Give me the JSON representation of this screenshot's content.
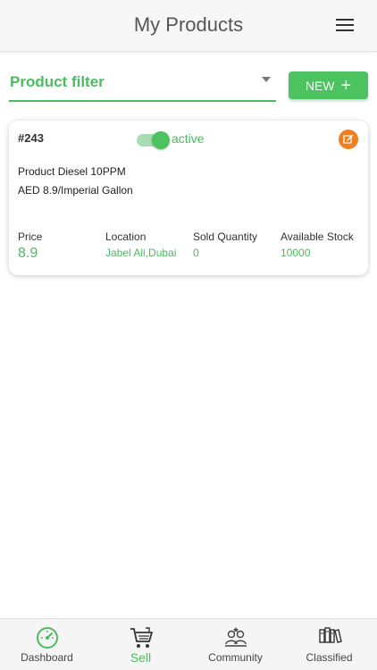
{
  "header": {
    "title": "My Products",
    "menu_icon": "hamburger-menu-icon"
  },
  "filter": {
    "label": "Product filter",
    "caret_icon": "dropdown-caret-icon"
  },
  "new_button": {
    "label": "NEW",
    "icon": "plus-icon"
  },
  "product": {
    "id": "#243",
    "active": true,
    "status_text": "active",
    "name": "Product Diesel 10PPM",
    "price_unit": "AED 8.9/Imperial Gallon",
    "edit_icon": "edit-icon",
    "stats": {
      "price_label": "Price",
      "price_value": "8.9",
      "location_label": "Location",
      "location_value": "Jabel Ali,Dubai",
      "sold_label": "Sold Quantity",
      "sold_value": "0",
      "stock_label": "Available Stock",
      "stock_value": "10000"
    }
  },
  "nav": {
    "items": [
      {
        "label": "Dashboard",
        "icon": "speedometer-icon",
        "active": false
      },
      {
        "label": "Sell",
        "icon": "cart-icon",
        "active": true
      },
      {
        "label": "Community",
        "icon": "community-icon",
        "active": false
      },
      {
        "label": "Classified",
        "icon": "books-icon",
        "active": false
      }
    ]
  },
  "colors": {
    "accent": "#4cbb61",
    "button": "#4cc35f",
    "edit": "#f07f1f",
    "toggle_track": "#a8dcb2"
  }
}
